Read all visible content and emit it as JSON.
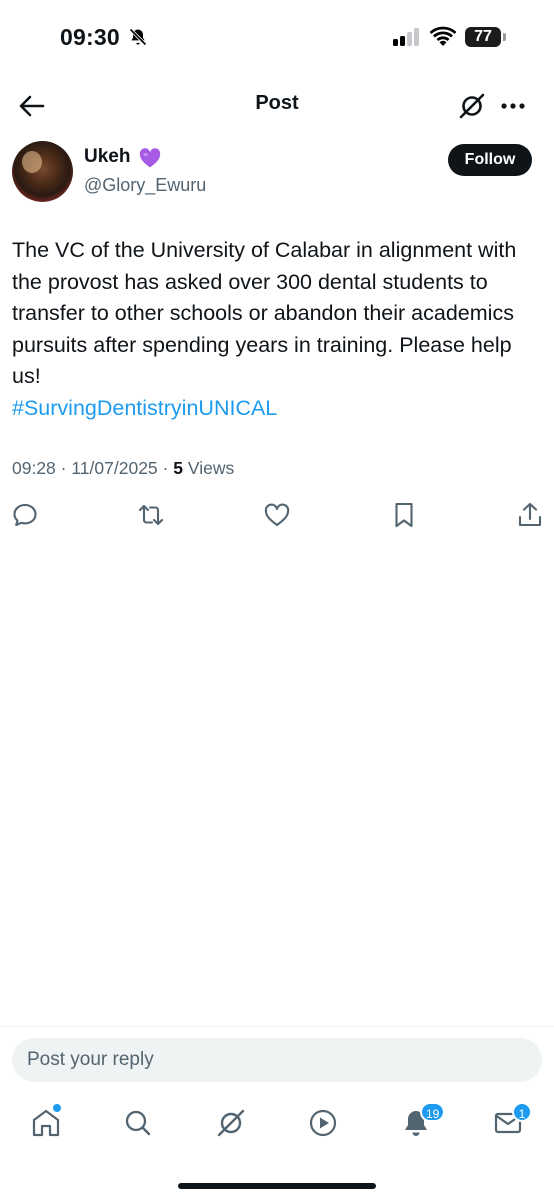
{
  "status_bar": {
    "time": "09:30",
    "battery": "77",
    "icons": [
      "bell-slash-icon",
      "signal-icon",
      "wifi-icon",
      "battery-icon"
    ]
  },
  "header": {
    "title": "Post",
    "icons": [
      "arrow-left-icon",
      "grok-icon",
      "more-horizontal-icon"
    ]
  },
  "post": {
    "author_name": "Ukeh",
    "author_emoji": "purple-heart-emoji",
    "author_handle": "@Glory_Ewuru",
    "follow_label": "Follow",
    "text": "The VC of the University of Calabar in alignment with the provost has asked over 300 dental students to transfer to other schools or abandon their academics pursuits after spending years in training. Please help us!",
    "hashtag": "#SurvingDentistryinUNICAL",
    "time": "09:28",
    "date": "11/07/2025",
    "views_count": "5",
    "views_label": "Views",
    "actions": [
      "reply-icon",
      "repost-icon",
      "like-icon",
      "bookmark-icon",
      "share-icon"
    ]
  },
  "reply": {
    "placeholder": "Post your reply"
  },
  "bottom_nav": {
    "items": [
      "home-icon",
      "search-icon",
      "grok-icon",
      "video-icon",
      "notifications-icon",
      "messages-icon"
    ],
    "notifications_badge": "19",
    "messages_badge": "1"
  },
  "colors": {
    "link": "#1d9bf0",
    "text": "#0f1419",
    "secondary": "#536471",
    "badge": "#1d9bf0"
  }
}
